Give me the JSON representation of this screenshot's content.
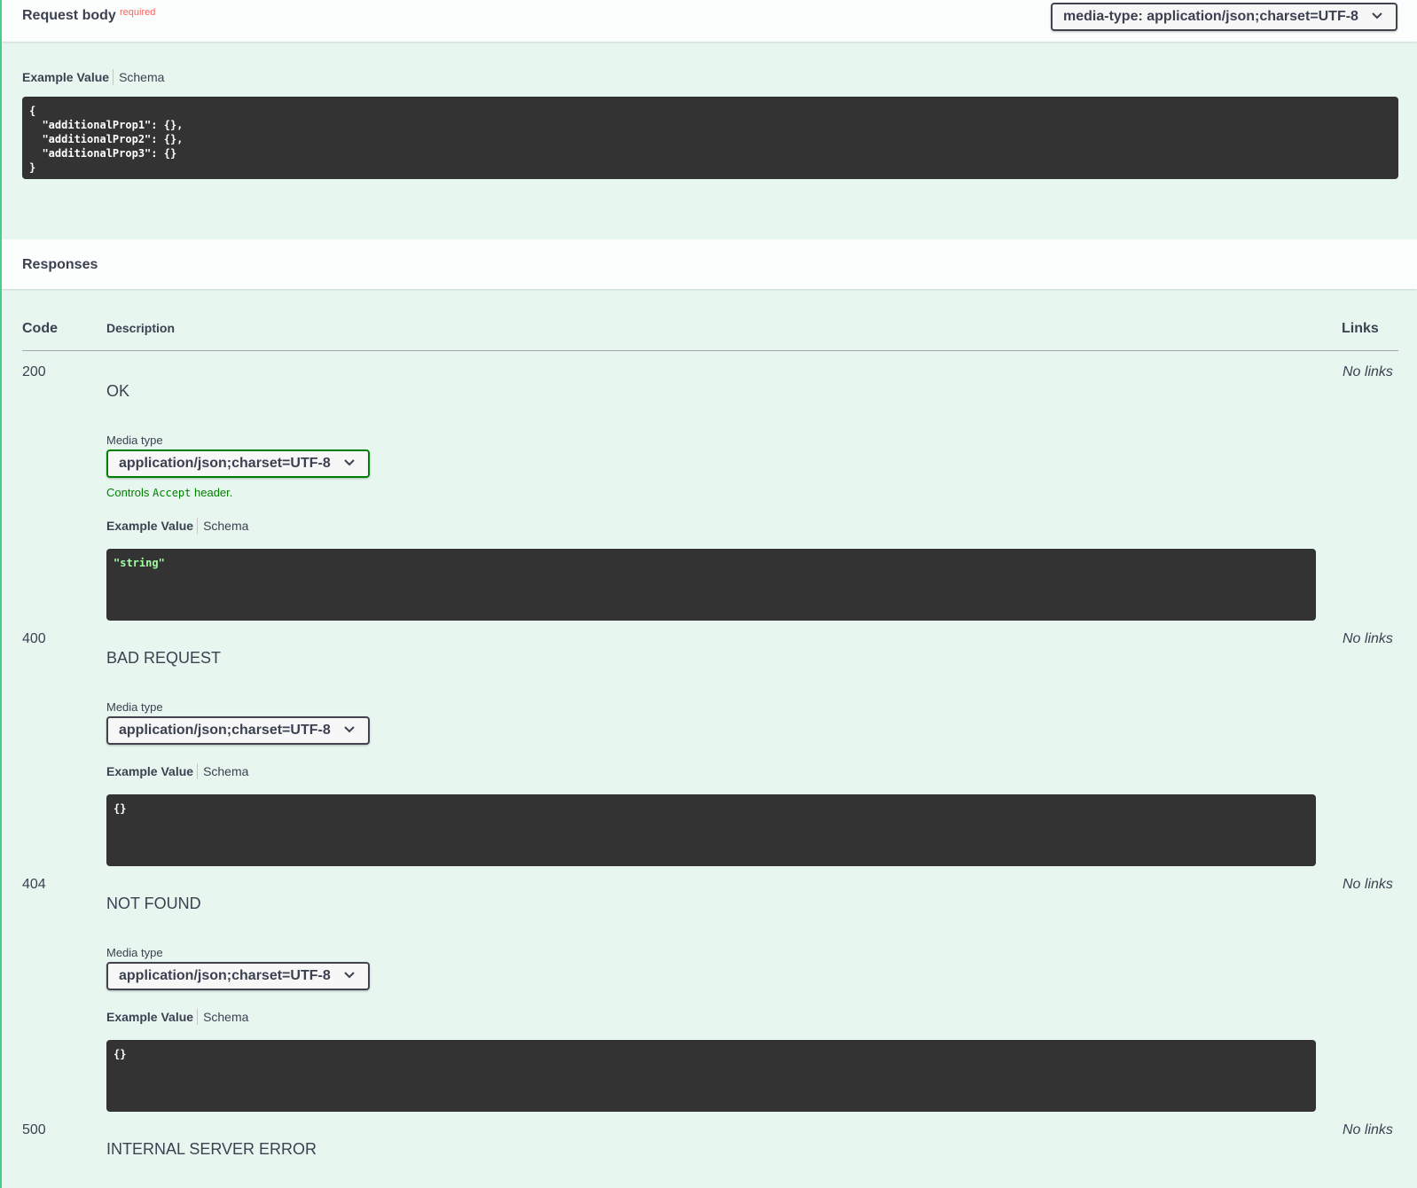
{
  "request_body": {
    "title": "Request body",
    "required_label": "required",
    "media_type_select": "media-type: application/json;charset=UTF-8",
    "tabs": {
      "example": "Example Value",
      "schema": "Schema"
    },
    "example_code": "{\n  \"additionalProp1\": {},\n  \"additionalProp2\": {},\n  \"additionalProp3\": {}\n}"
  },
  "responses": {
    "title": "Responses",
    "columns": {
      "code": "Code",
      "description": "Description",
      "links": "Links"
    },
    "media_type_label": "Media type",
    "controls_prefix": "Controls ",
    "controls_code": "Accept",
    "controls_suffix": " header.",
    "tabs": {
      "example": "Example Value",
      "schema": "Schema"
    },
    "items": [
      {
        "code": "200",
        "description": "OK",
        "links": "No links",
        "media_type": "application/json;charset=UTF-8",
        "example": "\"string\""
      },
      {
        "code": "400",
        "description": "BAD REQUEST",
        "links": "No links",
        "media_type": "application/json;charset=UTF-8",
        "example": "{}"
      },
      {
        "code": "404",
        "description": "NOT FOUND",
        "links": "No links",
        "media_type": "application/json;charset=UTF-8",
        "example": "{}"
      },
      {
        "code": "500",
        "description": "INTERNAL SERVER ERROR",
        "links": "No links"
      }
    ]
  },
  "colors": {
    "accent": "#49cc90",
    "panel": "#e8f6f0",
    "code_bg": "#333333",
    "string": "#a2fca2",
    "required": "#ff6060",
    "active_border": "#008000"
  },
  "icons": {
    "select_arrow": "chevron-down-icon"
  }
}
